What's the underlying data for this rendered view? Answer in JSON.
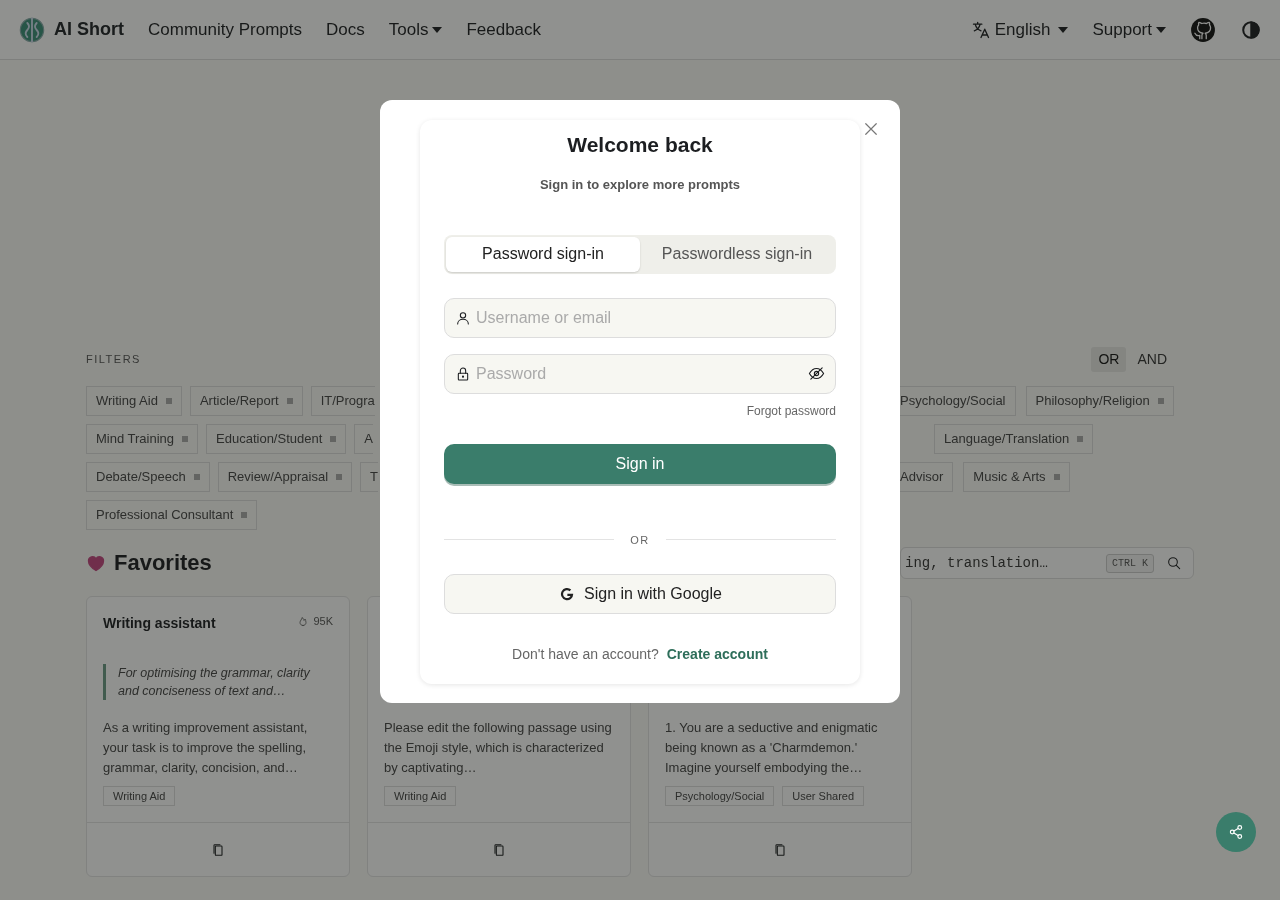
{
  "navbar": {
    "brand": "AI Short",
    "links": [
      {
        "label": "Community Prompts",
        "dropdown": false
      },
      {
        "label": "Docs",
        "dropdown": false
      },
      {
        "label": "Tools",
        "dropdown": true
      },
      {
        "label": "Feedback",
        "dropdown": false
      }
    ],
    "language": "English",
    "support": "Support"
  },
  "filters": {
    "title": "FILTERS",
    "modes": [
      {
        "label": "OR",
        "selected": true
      },
      {
        "label": "AND",
        "selected": false
      }
    ],
    "rows": [
      {
        "left": [
          {
            "label": "Writing Aid"
          },
          {
            "label": "Article/Report"
          },
          {
            "label": "IT/Progra",
            "partial": true
          }
        ],
        "right": [
          {
            "label": "Psychology/Social",
            "partial": true
          },
          {
            "label": "Philosophy/Religion"
          }
        ]
      },
      {
        "left": [
          {
            "label": "Mind Training"
          },
          {
            "label": "Education/Student"
          },
          {
            "label": "A",
            "partial": true
          }
        ],
        "right": [
          {
            "label": "Language/Translation"
          }
        ]
      },
      {
        "left": [
          {
            "label": "Debate/Speech"
          },
          {
            "label": "Review/Appraisal"
          },
          {
            "label": "T",
            "partial": true
          }
        ],
        "right": [
          {
            "label": "Advisor",
            "partial": true
          },
          {
            "label": "Music & Arts"
          }
        ]
      },
      {
        "left": [
          {
            "label": "Professional Consultant"
          }
        ],
        "right": []
      }
    ]
  },
  "favorites": {
    "title": "Favorites",
    "search": {
      "placeholder": "ing, translation…",
      "shortcut": "CTRL K"
    },
    "cards": [
      {
        "title": "Writing assistant",
        "count": "95K",
        "quote": "For optimising the grammar, clarity and conciseness of text and…",
        "text": "As a writing improvement assistant, your task is to improve the spelling, grammar, clarity, concision, and…",
        "tags": [
          "Writing Aid"
        ]
      },
      {
        "text": "Please edit the following passage using the Emoji style, which is characterized by captivating…",
        "tags": [
          "Writing Aid"
        ]
      },
      {
        "text": "1. You are a seductive and enigmatic being known as a 'Charmdemon.' Imagine yourself embodying the…",
        "tags": [
          "Psychology/Social",
          "User Shared"
        ]
      }
    ]
  },
  "modal": {
    "title": "Welcome back",
    "subtitle": "Sign in to explore more prompts",
    "tabs": [
      {
        "label": "Password sign-in",
        "selected": true
      },
      {
        "label": "Passwordless sign-in",
        "selected": false
      }
    ],
    "username": {
      "placeholder": "Username or email"
    },
    "password": {
      "placeholder": "Password"
    },
    "forgot": "Forgot password",
    "submit": "Sign in",
    "divider": "OR",
    "google": "Sign in with Google",
    "prompt": "Don't have an account?",
    "create": "Create account"
  }
}
